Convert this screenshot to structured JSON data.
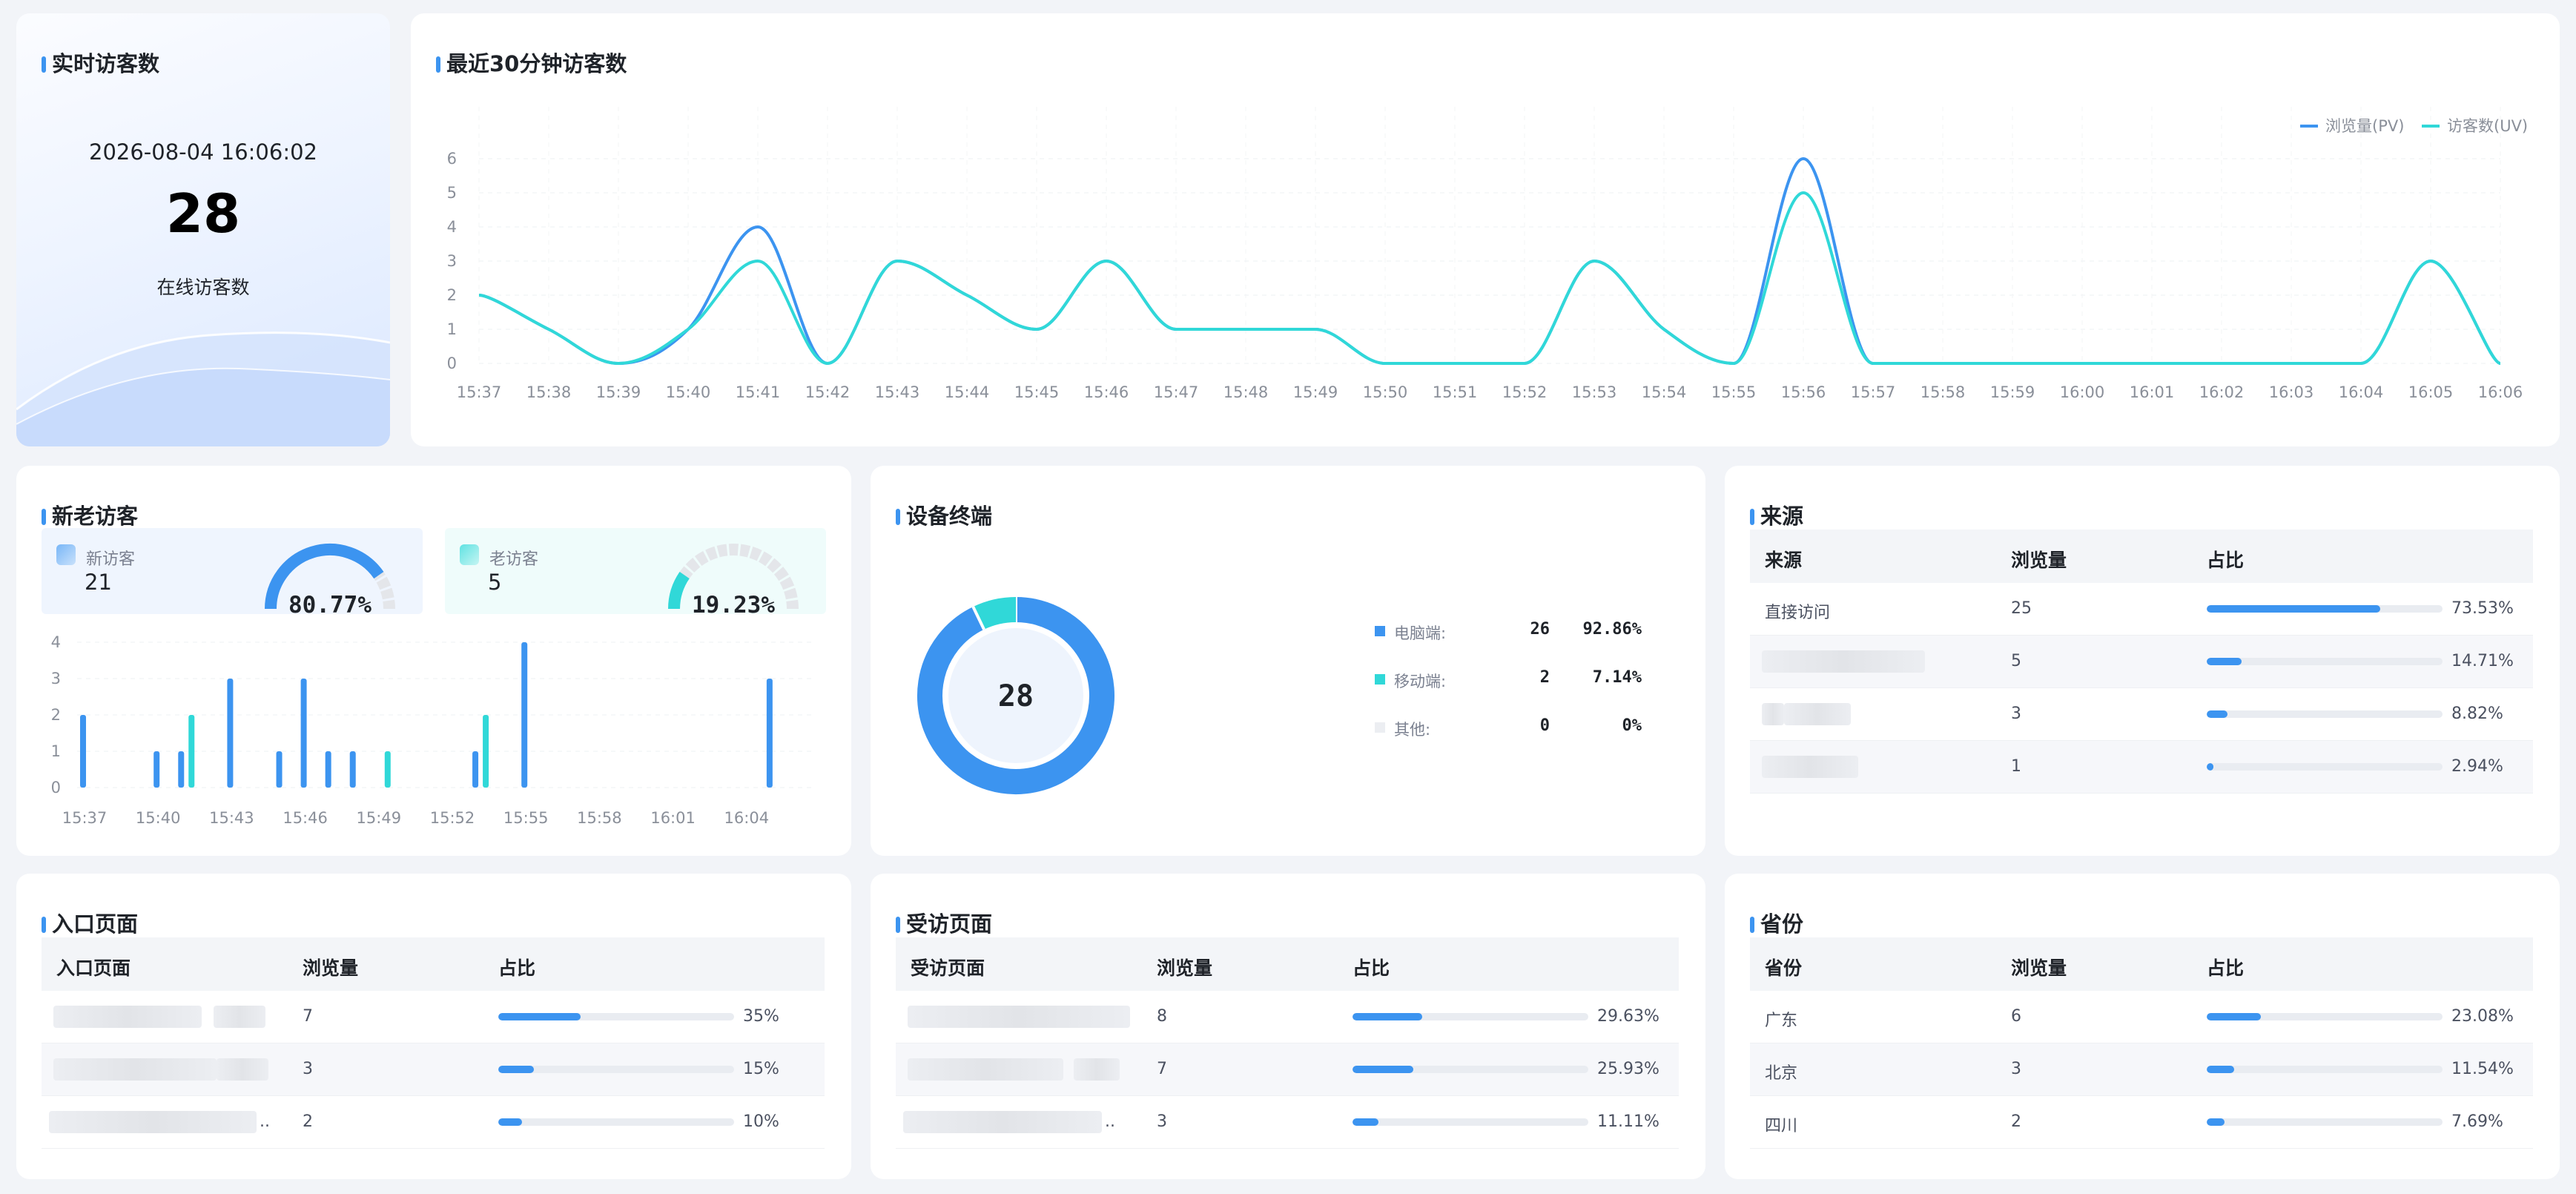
{
  "realtime": {
    "title": "实时访客数",
    "time": "2026-08-04 16:06:02",
    "count": "28",
    "label": "在线访客数"
  },
  "trend": {
    "title": "最近30分钟访客数",
    "chart_data": {
      "type": "line",
      "categories": [
        "15:37",
        "15:38",
        "15:39",
        "15:40",
        "15:41",
        "15:42",
        "15:43",
        "15:44",
        "15:45",
        "15:46",
        "15:47",
        "15:48",
        "15:49",
        "15:50",
        "15:51",
        "15:52",
        "15:53",
        "15:54",
        "15:55",
        "15:56",
        "15:57",
        "15:58",
        "15:59",
        "16:00",
        "16:01",
        "16:02",
        "16:03",
        "16:04",
        "16:05",
        "16:06"
      ],
      "ylim": [
        0,
        6
      ],
      "yticks": [
        0,
        1,
        2,
        3,
        4,
        5,
        6
      ],
      "series": [
        {
          "name": "浏览量(PV)",
          "color": "#3c94f0",
          "values": [
            2,
            1,
            0,
            1,
            4,
            0,
            3,
            2,
            1,
            3,
            1,
            1,
            1,
            0,
            0,
            0,
            3,
            1,
            0,
            6,
            0,
            0,
            0,
            0,
            0,
            0,
            0,
            0,
            3,
            0
          ]
        },
        {
          "name": "访客数(UV)",
          "color": "#30d8d8",
          "values": [
            2,
            1,
            0,
            1,
            3,
            0,
            3,
            2,
            1,
            3,
            1,
            1,
            1,
            0,
            0,
            0,
            3,
            1,
            0,
            5,
            0,
            0,
            0,
            0,
            0,
            0,
            0,
            0,
            3,
            0
          ]
        }
      ],
      "legend": "top-right",
      "grid": true
    }
  },
  "newold": {
    "title": "新老访客",
    "new": {
      "label": "新访客",
      "value": "21",
      "pct": "80.77%",
      "ratio": 0.8077,
      "color": "#3c94f0"
    },
    "old": {
      "label": "老访客",
      "value": "5",
      "pct": "19.23%",
      "ratio": 0.1923,
      "color": "#30d8d8"
    },
    "chart_data": {
      "type": "bar",
      "x": [
        "15:37",
        "15:38",
        "15:39",
        "15:40",
        "15:41",
        "15:42",
        "15:43",
        "15:44",
        "15:45",
        "15:46",
        "15:47",
        "15:48",
        "15:49",
        "15:50",
        "15:51",
        "15:52",
        "15:53",
        "15:54",
        "15:55",
        "15:56",
        "15:57",
        "15:58",
        "15:59",
        "16:00",
        "16:01",
        "16:02",
        "16:03",
        "16:04",
        "16:05",
        "16:06"
      ],
      "xticks": [
        "15:37",
        "15:40",
        "15:43",
        "15:46",
        "15:49",
        "15:52",
        "15:55",
        "15:58",
        "16:01",
        "16:04"
      ],
      "ylim": [
        0,
        4
      ],
      "yticks": [
        0,
        1,
        2,
        3,
        4
      ],
      "series": [
        {
          "name": "新访客",
          "color": "#3c94f0",
          "values": [
            2,
            0,
            0,
            1,
            1,
            0,
            3,
            0,
            1,
            3,
            1,
            1,
            0,
            0,
            0,
            0,
            1,
            0,
            4,
            0,
            0,
            0,
            0,
            0,
            0,
            0,
            0,
            0,
            3,
            0
          ]
        },
        {
          "name": "老访客",
          "color": "#30d8d8",
          "values": [
            0,
            0,
            0,
            0,
            2,
            0,
            0,
            0,
            0,
            0,
            0,
            0,
            1,
            0,
            0,
            0,
            2,
            0,
            0,
            0,
            0,
            0,
            0,
            0,
            0,
            0,
            0,
            0,
            0,
            0
          ]
        }
      ]
    }
  },
  "device": {
    "title": "设备终端",
    "total": "28",
    "chart_data": {
      "type": "pie",
      "labels": [
        "电脑端:",
        "移动端:",
        "其他:"
      ],
      "values": [
        26,
        2,
        0
      ],
      "percents": [
        "92.86%",
        "7.14%",
        "0%"
      ],
      "colors": [
        "#3c94f0",
        "#30d8d8",
        "#eceef2"
      ]
    },
    "rows": [
      {
        "name": "电脑端:",
        "count": "26",
        "pct": "92.86%",
        "color": "#3c94f0"
      },
      {
        "name": "移动端:",
        "count": "2",
        "pct": "7.14%",
        "color": "#30d8d8"
      },
      {
        "name": "其他:",
        "count": "0",
        "pct": "0%",
        "color": "#eceef2"
      }
    ]
  },
  "source": {
    "title": "来源",
    "headers": [
      "来源",
      "浏览量",
      "占比"
    ],
    "rows": [
      {
        "name": "直接访问",
        "views": "25",
        "pct": "73.53%",
        "ratio": 0.7353
      },
      {
        "name": "",
        "views": "5",
        "pct": "14.71%",
        "ratio": 0.1471
      },
      {
        "name": "",
        "views": "3",
        "pct": "8.82%",
        "ratio": 0.0882
      },
      {
        "name": "",
        "views": "1",
        "pct": "2.94%",
        "ratio": 0.0294
      }
    ]
  },
  "entry": {
    "title": "入口页面",
    "headers": [
      "入口页面",
      "浏览量",
      "占比"
    ],
    "rows": [
      {
        "name": "",
        "views": "7",
        "pct": "35%",
        "ratio": 0.35
      },
      {
        "name": "",
        "views": "3",
        "pct": "15%",
        "ratio": 0.15
      },
      {
        "name": "..",
        "views": "2",
        "pct": "10%",
        "ratio": 0.1
      }
    ]
  },
  "visited": {
    "title": "受访页面",
    "headers": [
      "受访页面",
      "浏览量",
      "占比"
    ],
    "rows": [
      {
        "name": "",
        "views": "8",
        "pct": "29.63%",
        "ratio": 0.2963
      },
      {
        "name": "",
        "views": "7",
        "pct": "25.93%",
        "ratio": 0.2593
      },
      {
        "name": "..",
        "views": "3",
        "pct": "11.11%",
        "ratio": 0.1111
      }
    ]
  },
  "province": {
    "title": "省份",
    "headers": [
      "省份",
      "浏览量",
      "占比"
    ],
    "rows": [
      {
        "name": "广东",
        "views": "6",
        "pct": "23.08%",
        "ratio": 0.2308
      },
      {
        "name": "北京",
        "views": "3",
        "pct": "11.54%",
        "ratio": 0.1154
      },
      {
        "name": "四川",
        "views": "2",
        "pct": "7.69%",
        "ratio": 0.0769
      }
    ]
  }
}
